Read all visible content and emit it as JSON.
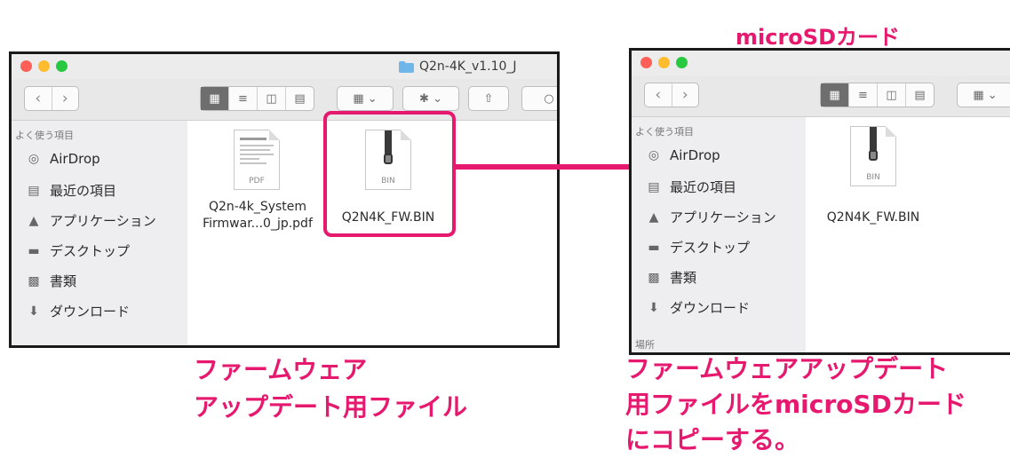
{
  "colors": {
    "accent": "#e6196f",
    "traffic_red": "#ff5f57",
    "traffic_yellow": "#febc2e",
    "traffic_green": "#28c840",
    "folder_blue": "#6fb7e8"
  },
  "left_window": {
    "title": "Q2n-4K_v1.10_J",
    "sidebar": {
      "header": "よく使う項目",
      "items": [
        {
          "label": "AirDrop",
          "icon": "airdrop-icon"
        },
        {
          "label": "最近の項目",
          "icon": "recents-icon"
        },
        {
          "label": "アプリケーション",
          "icon": "applications-icon"
        },
        {
          "label": "デスクトップ",
          "icon": "desktop-icon"
        },
        {
          "label": "書類",
          "icon": "documents-icon"
        },
        {
          "label": "ダウンロード",
          "icon": "downloads-icon"
        }
      ]
    },
    "files": [
      {
        "name_line1": "Q2n-4k_System",
        "name_line2": "Firmwar...0_jp.pdf",
        "type": "PDF"
      },
      {
        "name": "Q2N4K_FW.BIN",
        "type": "BIN"
      }
    ]
  },
  "right_window": {
    "sidebar": {
      "header": "よく使う項目",
      "items": [
        {
          "label": "AirDrop",
          "icon": "airdrop-icon"
        },
        {
          "label": "最近の項目",
          "icon": "recents-icon"
        },
        {
          "label": "アプリケーション",
          "icon": "applications-icon"
        },
        {
          "label": "デスクトップ",
          "icon": "desktop-icon"
        },
        {
          "label": "書類",
          "icon": "documents-icon"
        },
        {
          "label": "ダウンロード",
          "icon": "downloads-icon"
        }
      ],
      "partial_next_header": "場所"
    },
    "files": [
      {
        "name": "Q2N4K_FW.BIN",
        "type": "BIN"
      }
    ]
  },
  "captions": {
    "top_right": "microSDカード",
    "left_line1": "ファームウェア",
    "left_line2": "アップデート用ファイル",
    "right_line1": "ファームウェアアップデート",
    "right_line2": "用ファイルをmicroSDカード",
    "right_line3": "にコピーする。"
  }
}
